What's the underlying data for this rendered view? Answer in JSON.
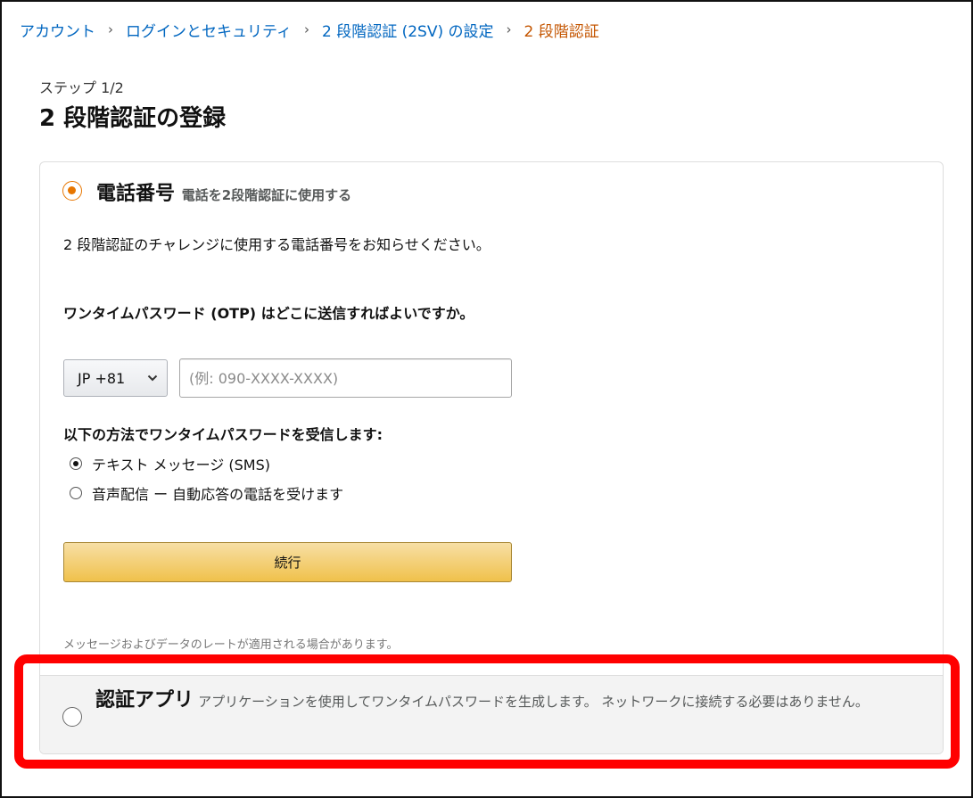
{
  "breadcrumb": {
    "items": [
      "アカウント",
      "ログインとセキュリティ",
      "2 段階認証 (2SV) の設定"
    ],
    "current": "2 段階認証",
    "separator": "›"
  },
  "step": "ステップ 1/2",
  "title": "2 段階認証の登録",
  "phone_option": {
    "title": "電話番号",
    "description": "電話を2段階認証に使用する",
    "selected": true,
    "instruction": "2 段階認証のチャレンジに使用する電話番号をお知らせください。",
    "otp_question": "ワンタイムパスワード (OTP) はどこに送信すればよいですか。",
    "country_select": "JP +81",
    "phone_placeholder": "(例: 090-XXXX-XXXX)",
    "phone_value": "",
    "method_label": "以下の方法でワンタイムパスワードを受信します:",
    "methods": [
      {
        "label": "テキスト メッセージ (SMS)",
        "selected": true
      },
      {
        "label": "音声配信 ー 自動応答の電話を受けます",
        "selected": false
      }
    ],
    "continue_label": "続行",
    "note": "メッセージおよびデータのレートが適用される場合があります。"
  },
  "app_option": {
    "title": "認証アプリ",
    "description": "アプリケーションを使用してワンタイムパスワードを生成します。 ネットワークに接続する必要はありません。",
    "selected": false
  },
  "colors": {
    "link": "#0066c0",
    "current_crumb": "#c45500",
    "accent_radio": "#e77600",
    "button_top": "#f7dfa5",
    "button_bottom": "#f0c14b",
    "highlight": "#ff0000"
  },
  "icons": {
    "select_arrow": "chevron-down-icon"
  }
}
